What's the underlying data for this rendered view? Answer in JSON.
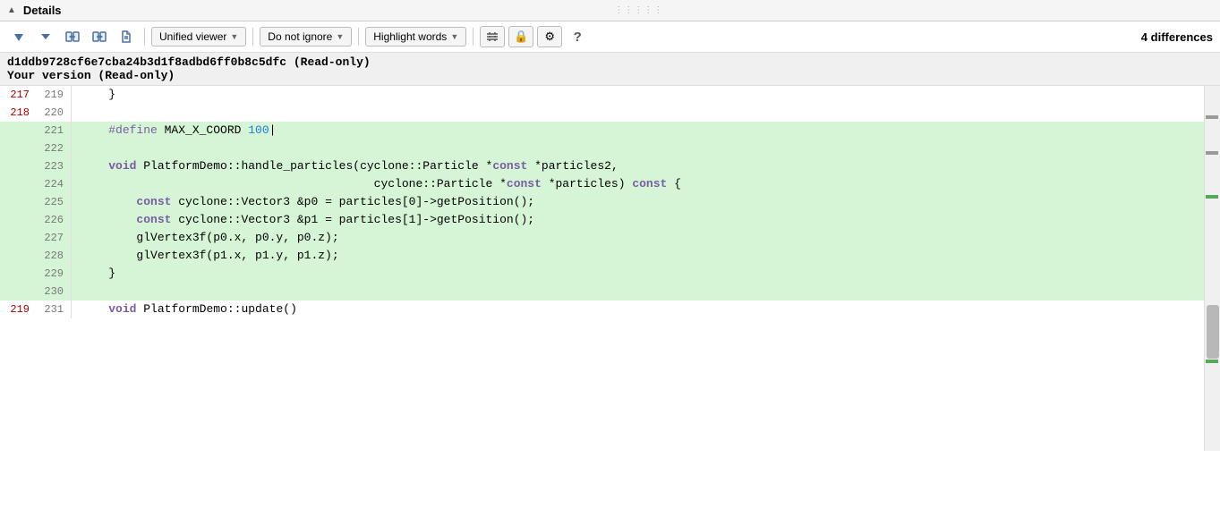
{
  "header": {
    "triangle": "▲",
    "title": "Details",
    "drag_handle": "⋮⋮⋮⋮⋮"
  },
  "toolbar": {
    "up_arrow": "↑",
    "down_arrow": "↓",
    "copy_left": "⬛",
    "copy_right_1": "⬛",
    "file_icon": "⬛",
    "unified_viewer_label": "Unified viewer",
    "unified_viewer_arrow": "▼",
    "do_not_ignore_label": "Do not ignore",
    "do_not_ignore_arrow": "▼",
    "highlight_words_label": "Highlight words",
    "highlight_words_arrow": "▼",
    "settings_icon": "⚙",
    "lock_icon": "🔒",
    "gear_icon": "⚙",
    "question_icon": "?",
    "diff_count": "4 differences"
  },
  "file_info": {
    "hash": "d1ddb9728cf6e7cba24b3d1f8adbd6ff0b8c5dfc (Read-only)",
    "version": "Your version (Read-only)"
  },
  "diff_lines": [
    {
      "left_num": "217",
      "right_num": "219",
      "type": "normal",
      "content": "    }"
    },
    {
      "left_num": "218",
      "right_num": "220",
      "type": "normal",
      "content": ""
    },
    {
      "left_num": "",
      "right_num": "221",
      "type": "added",
      "content_html": "    <span class='kw-define'>#define</span> MAX_X_COORD <span class='num'>100</span>|"
    },
    {
      "left_num": "",
      "right_num": "222",
      "type": "added",
      "content": ""
    },
    {
      "left_num": "",
      "right_num": "223",
      "type": "added",
      "content_html": "    <span class='kw-void'>void</span> PlatformDemo::handle_particles(cyclone::Particle *<span class='kw-const'>const</span> *particles2,"
    },
    {
      "left_num": "",
      "right_num": "224",
      "type": "added",
      "content_html": "                                          cyclone::Particle *<span class='kw-const'>const</span> *particles) <span class='kw-const'>const</span> {"
    },
    {
      "left_num": "",
      "right_num": "225",
      "type": "added",
      "content_html": "        <span class='kw-const'>const</span> cyclone::Vector3 &amp;p0 = particles[0]-&gt;getPosition();"
    },
    {
      "left_num": "",
      "right_num": "226",
      "type": "added",
      "content_html": "        <span class='kw-const'>const</span> cyclone::Vector3 &amp;p1 = particles[1]-&gt;getPosition();"
    },
    {
      "left_num": "",
      "right_num": "227",
      "type": "added",
      "content": "        glVertex3f(p0.x, p0.y, p0.z);"
    },
    {
      "left_num": "",
      "right_num": "228",
      "type": "added",
      "content": "        glVertex3f(p1.x, p1.y, p1.z);"
    },
    {
      "left_num": "",
      "right_num": "229",
      "type": "added",
      "content": "    }"
    },
    {
      "left_num": "",
      "right_num": "230",
      "type": "added",
      "content": ""
    },
    {
      "left_num": "219",
      "right_num": "231",
      "type": "normal",
      "content_html": "    <span class='kw-void'>void</span> PlatformDemo::update()"
    }
  ],
  "scroll_markers": [
    {
      "top_pct": 8,
      "type": "modified"
    },
    {
      "top_pct": 18,
      "type": "modified"
    },
    {
      "top_pct": 30,
      "type": "added"
    },
    {
      "top_pct": 75,
      "type": "added"
    }
  ]
}
